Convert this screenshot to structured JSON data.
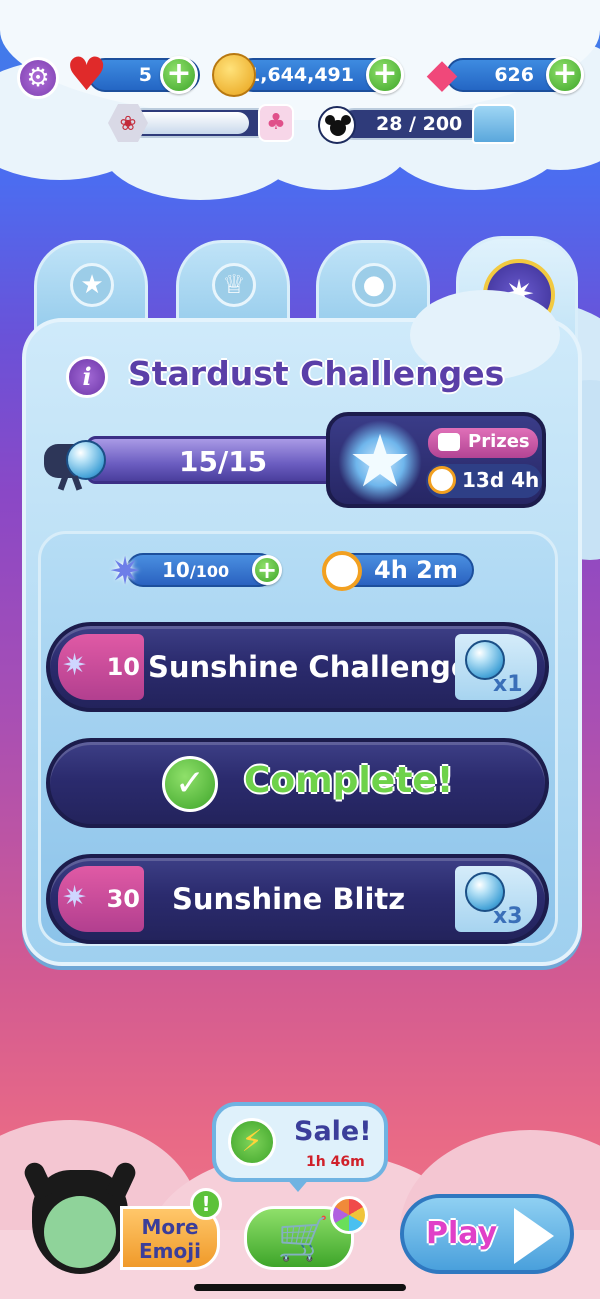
{
  "topbar": {
    "lives": "5",
    "coins": "1,644,491",
    "gems": "626",
    "xp_progress": "28 / 200",
    "cake_progress": 0.8
  },
  "tabs": [
    {
      "icon": "star-icon"
    },
    {
      "icon": "trophy-icon"
    },
    {
      "icon": "mickey-icon"
    },
    {
      "icon": "stardust-icon",
      "active": true
    }
  ],
  "panel": {
    "title": "Stardust Challenges",
    "progress_text": "15/15",
    "progress_fraction": 1.0,
    "prizes_label": "Prizes",
    "timer": "13d 4h"
  },
  "challenges_header": {
    "stardust": "10",
    "stardust_max": "/100",
    "timer": "4h 2m"
  },
  "challenges": [
    {
      "reward": "10",
      "title": "Sunshine Challenge",
      "multiplier": "x1"
    },
    {
      "complete_label": "Complete!"
    },
    {
      "reward": "30",
      "title": "Sunshine Blitz",
      "multiplier": "x3"
    }
  ],
  "bottom": {
    "sale_label": "Sale!",
    "sale_timer": "1h 46m",
    "more_emoji_line1": "More",
    "more_emoji_line2": "Emoji",
    "badge": "!",
    "play_label": "Play"
  },
  "colors": {
    "accent_green": "#3ea52a",
    "complete_text": "#6ed24a",
    "title_purple": "#5a3fa8",
    "challenge_bg": "#2b2b6e"
  }
}
